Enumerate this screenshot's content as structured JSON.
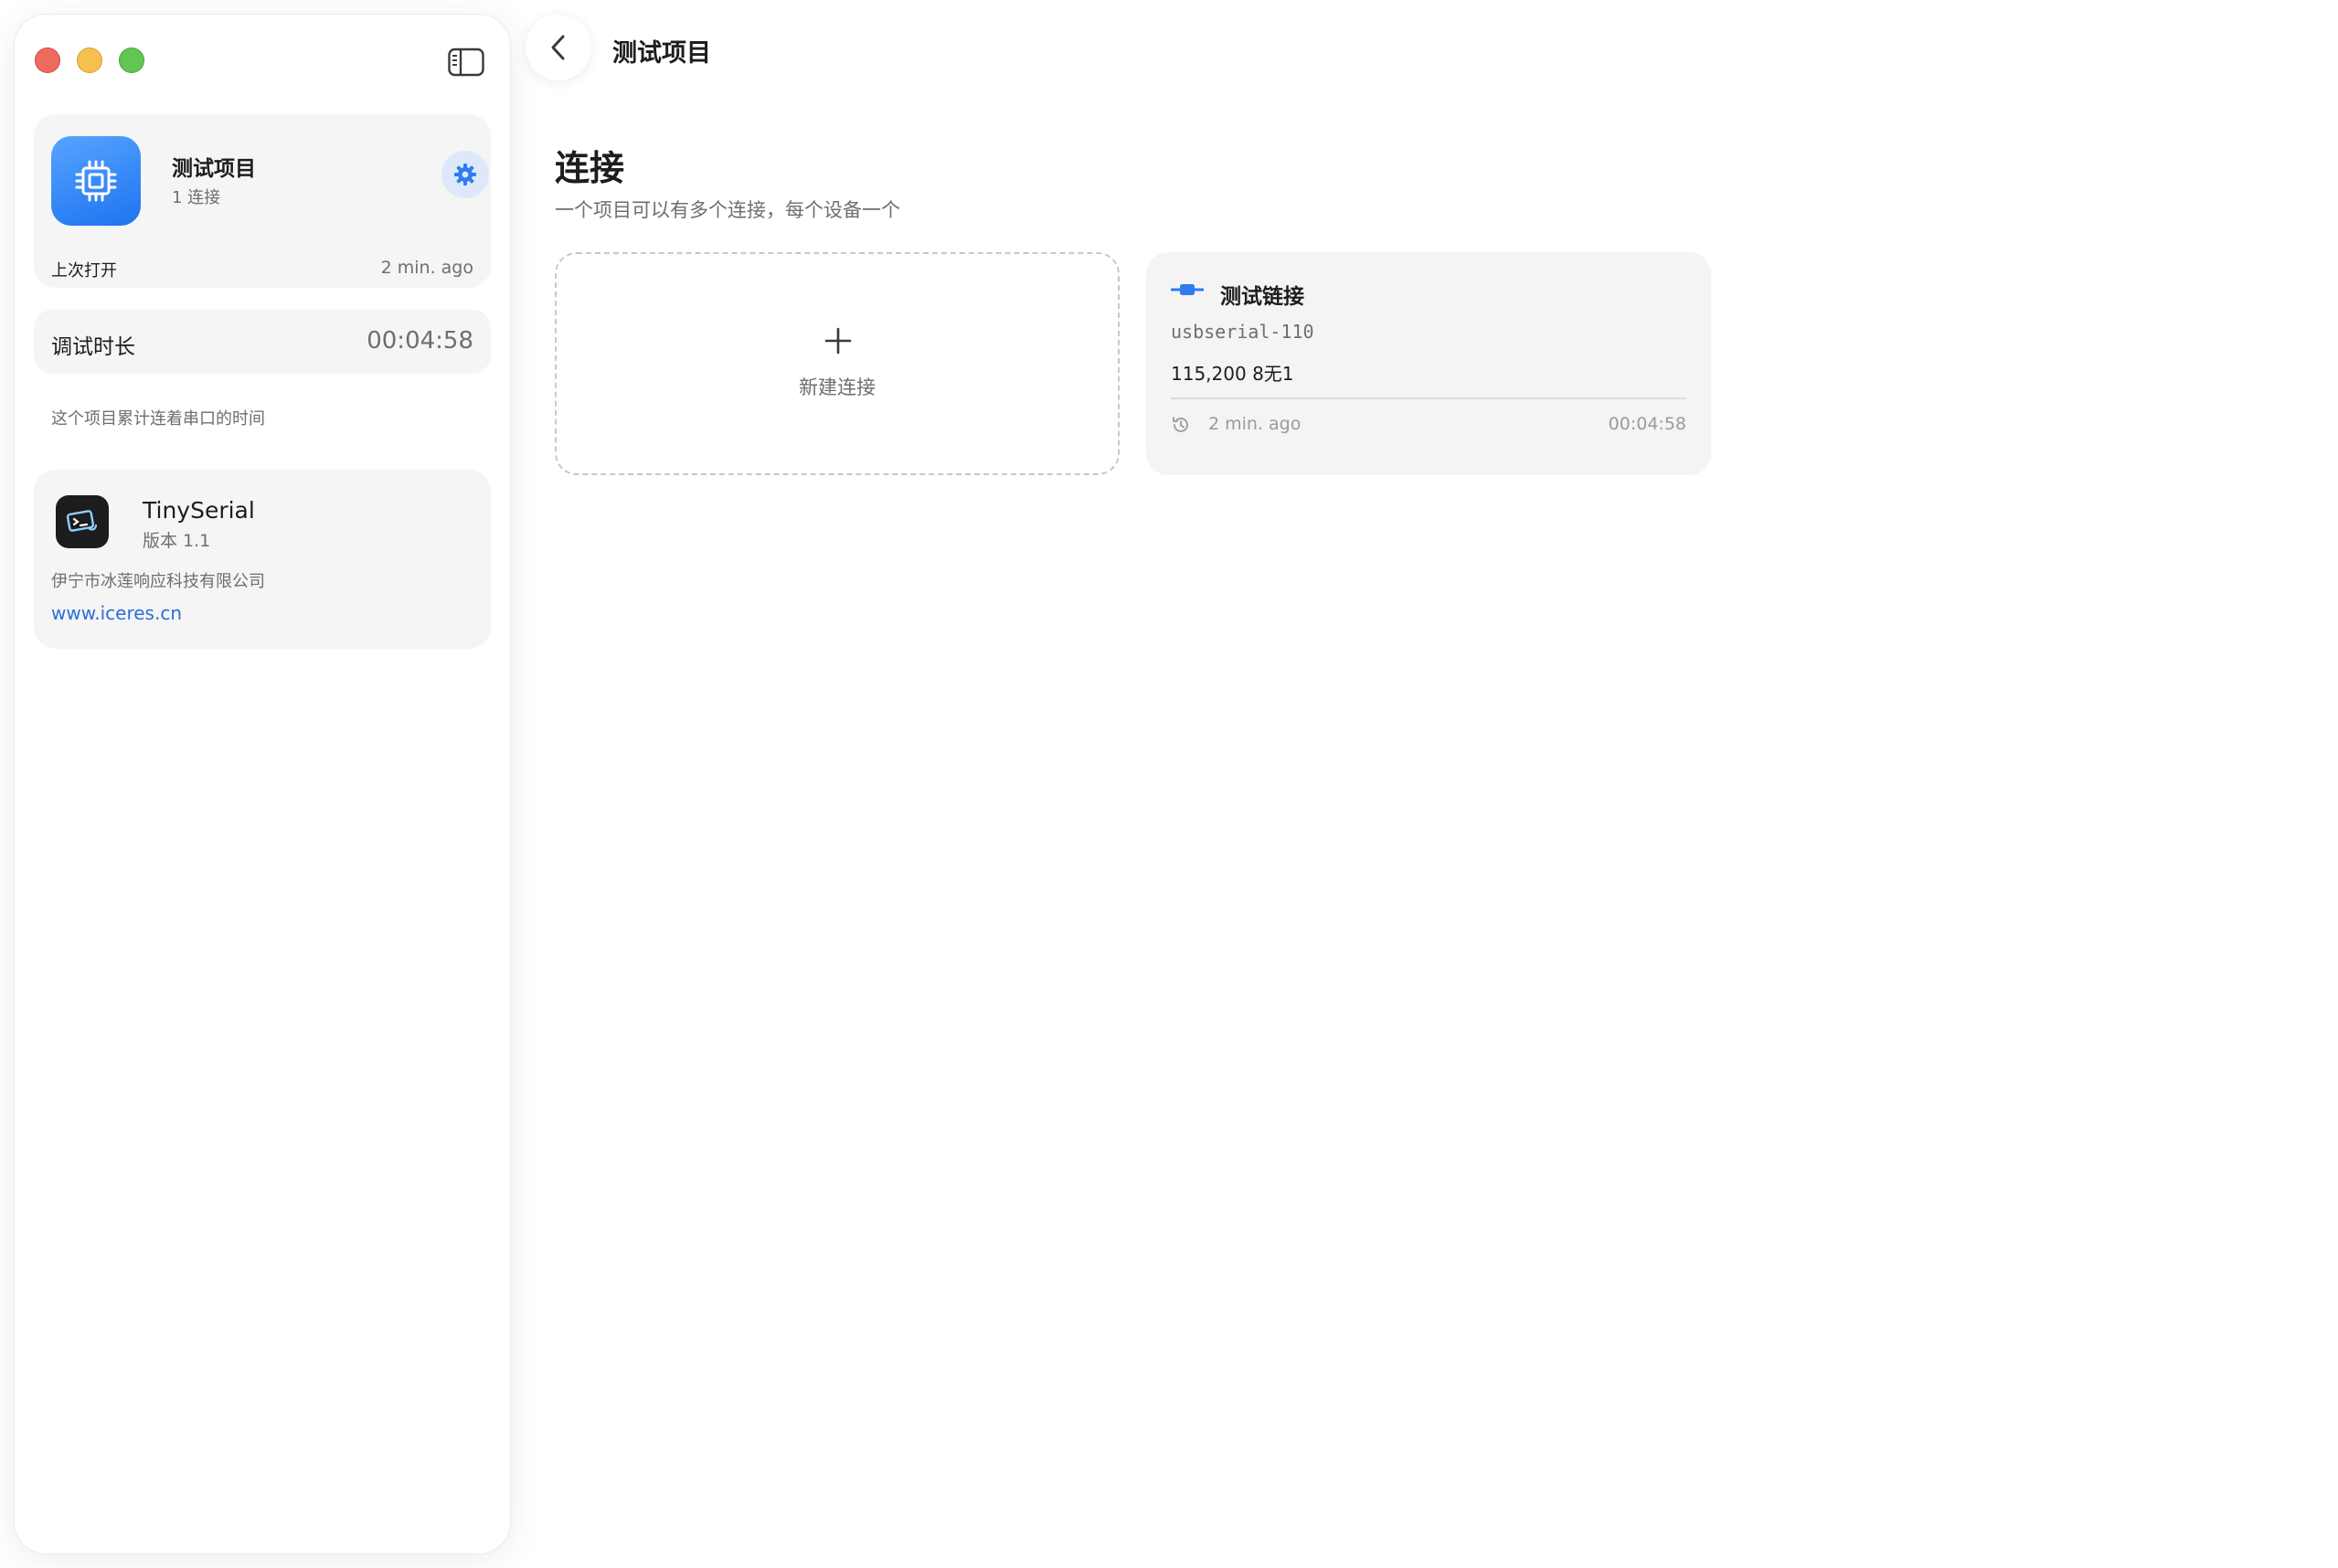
{
  "window": {
    "title": "测试项目"
  },
  "sidebar": {
    "project": {
      "name": "测试项目",
      "connections": "1 连接",
      "last_open_label": "上次打开",
      "last_open_value": "2 min. ago",
      "icon": "cpu-chip-icon"
    },
    "duration": {
      "label": "调试时长",
      "value": "00:04:58",
      "hint": "这个项目累计连着串口的时间"
    },
    "about": {
      "app_name": "TinySerial",
      "version": "版本 1.1",
      "company": "伊宁市冰莲响应科技有限公司",
      "website": "www.iceres.cn"
    }
  },
  "main": {
    "nav_title": "测试项目",
    "section_title": "连接",
    "section_subtitle": "一个项目可以有多个连接，每个设备一个",
    "new_connection_label": "新建连接",
    "connections": [
      {
        "name": "测试链接",
        "port": "usbserial-110",
        "params": "115,200   8无1",
        "last_used": "2 min. ago",
        "duration": "00:04:58"
      }
    ]
  },
  "colors": {
    "accent": "#1e73f0",
    "link": "#2b6fd6",
    "card_bg": "#f5f5f5"
  }
}
